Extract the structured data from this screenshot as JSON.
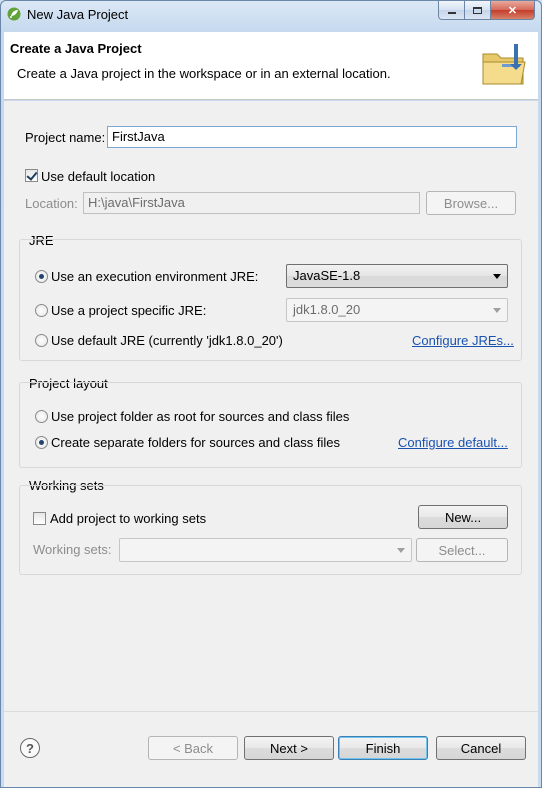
{
  "window": {
    "title": "New Java Project"
  },
  "banner": {
    "title": "Create a Java Project",
    "description": "Create a Java project in the workspace or in an external location."
  },
  "project": {
    "name_label": "Project name:",
    "name_value": "FirstJava",
    "use_default_location_label": "Use default location",
    "use_default_location_checked": true,
    "location_label": "Location:",
    "location_value": "H:\\java\\FirstJava",
    "browse_label": "Browse..."
  },
  "jre": {
    "group_title": "JRE",
    "option_env_label": "Use an execution environment JRE:",
    "option_env_value": "JavaSE-1.8",
    "option_specific_label": "Use a project specific JRE:",
    "option_specific_value": "jdk1.8.0_20",
    "option_default_label": "Use default JRE (currently 'jdk1.8.0_20')",
    "configure_link": "Configure JREs...",
    "selected": "env"
  },
  "layout": {
    "group_title": "Project layout",
    "option_root_label": "Use project folder as root for sources and class files",
    "option_separate_label": "Create separate folders for sources and class files",
    "configure_link": "Configure default...",
    "selected": "separate"
  },
  "working_sets": {
    "group_title": "Working sets",
    "add_label": "Add project to working sets",
    "add_checked": false,
    "new_label": "New...",
    "sets_label": "Working sets:",
    "sets_value": "",
    "select_label": "Select..."
  },
  "footer": {
    "help_symbol": "?",
    "back_label": "< Back",
    "next_label": "Next >",
    "finish_label": "Finish",
    "cancel_label": "Cancel"
  },
  "icons": {
    "app": "eclipse-spring-icon",
    "banner": "java-project-folder-icon",
    "help": "help-icon"
  },
  "colors": {
    "accent": "#3c7fb1",
    "link": "#1a52b0"
  }
}
